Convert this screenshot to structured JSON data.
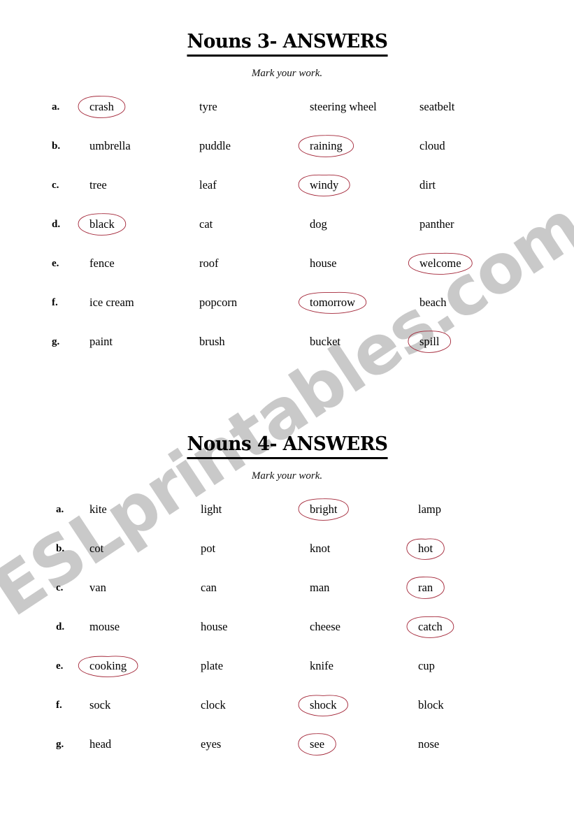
{
  "document": {
    "watermark_text": "ESLprintables.com",
    "watermark_color": "#c9c9c9",
    "answer_circle_color": "#a32638",
    "text_color": "#000000"
  },
  "sections": [
    {
      "title": "Nouns 3- ANSWERS",
      "subtitle": "Mark your work.",
      "rows": [
        {
          "label": "a.",
          "words": [
            "crash",
            "tyre",
            "steering wheel",
            "seatbelt"
          ],
          "answer_index": 0
        },
        {
          "label": "b.",
          "words": [
            "umbrella",
            "puddle",
            "raining",
            "cloud"
          ],
          "answer_index": 2
        },
        {
          "label": "c.",
          "words": [
            "tree",
            "leaf",
            "windy",
            "dirt"
          ],
          "answer_index": 2
        },
        {
          "label": "d.",
          "words": [
            "black",
            "cat",
            "dog",
            "panther"
          ],
          "answer_index": 0
        },
        {
          "label": "e.",
          "words": [
            "fence",
            "roof",
            "house",
            "welcome"
          ],
          "answer_index": 3
        },
        {
          "label": "f.",
          "words": [
            "ice cream",
            "popcorn",
            "tomorrow",
            "beach"
          ],
          "answer_index": 2
        },
        {
          "label": "g.",
          "words": [
            "paint",
            "brush",
            "bucket",
            "spill"
          ],
          "answer_index": 3
        }
      ]
    },
    {
      "title": "Nouns 4- ANSWERS",
      "subtitle": "Mark your work.",
      "rows": [
        {
          "label": "a.",
          "words": [
            "kite",
            "light",
            "bright",
            "lamp"
          ],
          "answer_index": 2
        },
        {
          "label": "b.",
          "words": [
            "cot",
            "pot",
            "knot",
            "hot"
          ],
          "answer_index": 3
        },
        {
          "label": "c.",
          "words": [
            "van",
            "can",
            "man",
            "ran"
          ],
          "answer_index": 3
        },
        {
          "label": "d.",
          "words": [
            "mouse",
            "house",
            "cheese",
            "catch"
          ],
          "answer_index": 3
        },
        {
          "label": "e.",
          "words": [
            "cooking",
            "plate",
            "knife",
            "cup"
          ],
          "answer_index": 0
        },
        {
          "label": "f.",
          "words": [
            "sock",
            "clock",
            "shock",
            "block"
          ],
          "answer_index": 2
        },
        {
          "label": "g.",
          "words": [
            "head",
            "eyes",
            "see",
            "nose"
          ],
          "answer_index": 2
        }
      ]
    }
  ]
}
